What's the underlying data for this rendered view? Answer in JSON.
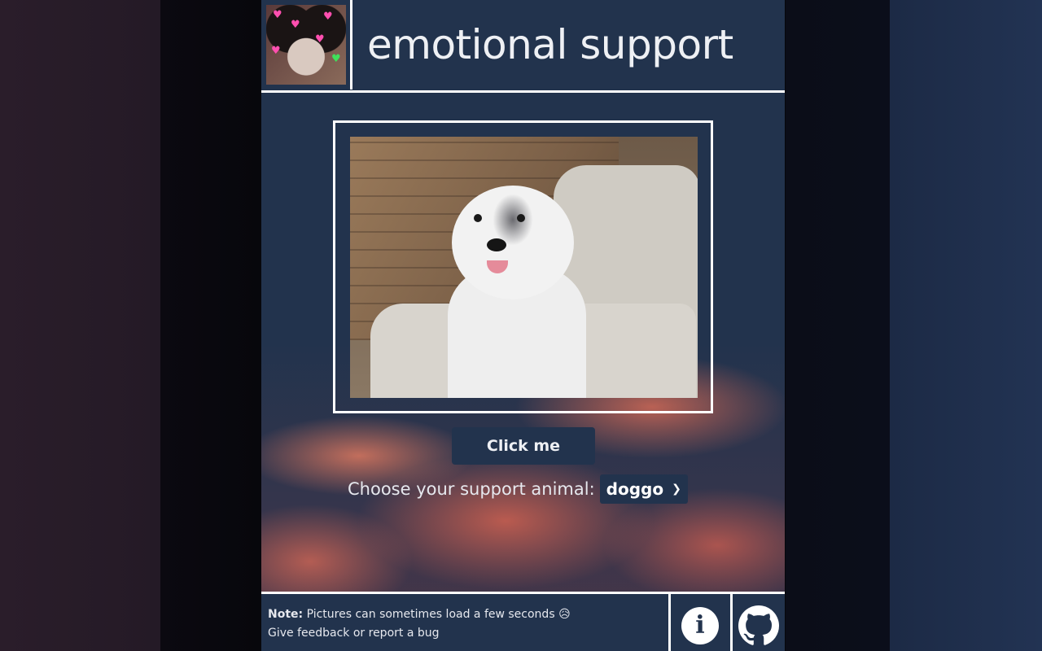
{
  "header": {
    "title": "emotional support",
    "avatar_icon": "cat-avatar-with-hearts"
  },
  "image": {
    "subject_icon": "husky-dog-photo"
  },
  "actions": {
    "click_label": "Click me"
  },
  "chooser": {
    "label": "Choose your support animal:",
    "selected": "doggo"
  },
  "footer": {
    "note_bold": "Note:",
    "note_text": " Pictures can sometimes load a few seconds 😥",
    "feedback_text": "Give feedback or report a bug",
    "info_icon": "info-icon",
    "github_icon": "github-icon"
  },
  "colors": {
    "panel_bg": "#22334d",
    "border": "#ffffff",
    "text": "#eef0f4"
  }
}
